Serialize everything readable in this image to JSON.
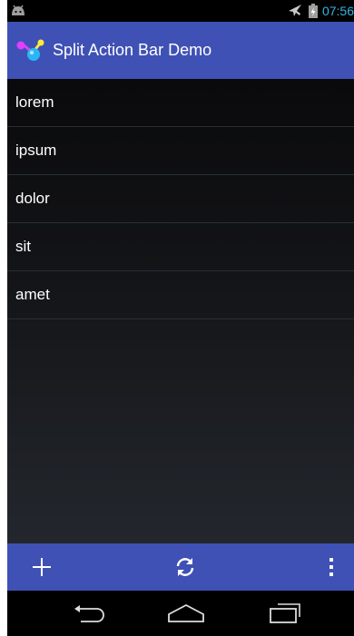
{
  "status_bar": {
    "time": "07:56",
    "icons": [
      "android-icon",
      "airplane-mode-icon",
      "battery-charging-icon"
    ]
  },
  "action_bar": {
    "title": "Split Action Bar Demo",
    "icon": "app-icon"
  },
  "list": {
    "items": [
      "lorem",
      "ipsum",
      "dolor",
      "sit",
      "amet"
    ]
  },
  "split_action_bar": {
    "actions": [
      "add-icon",
      "refresh-icon",
      "overflow-menu-icon"
    ]
  },
  "navigation_bar": {
    "buttons": [
      "back-icon",
      "home-icon",
      "recents-icon"
    ]
  },
  "colors": {
    "action_bar": "#3f51b5",
    "status_time": "#33b5e5",
    "list_text": "#ffffff"
  }
}
